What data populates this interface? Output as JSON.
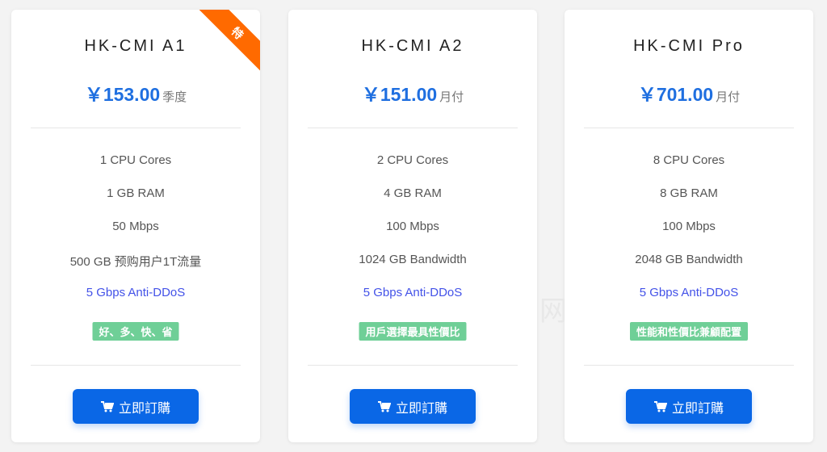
{
  "plans": [
    {
      "title": "HK-CMI A1",
      "price": "￥153.00",
      "period": "季度",
      "features": [
        "1 CPU Cores",
        "1 GB RAM",
        "50 Mbps",
        "500 GB 预购用户1T流量"
      ],
      "ddos": "5 Gbps Anti-DDoS",
      "badge": "好、多、快、省",
      "button_label": "立即訂購",
      "ribbon": "特"
    },
    {
      "title": "HK-CMI A2",
      "price": "￥151.00",
      "period": "月付",
      "features": [
        "2 CPU Cores",
        "4 GB RAM",
        "100 Mbps",
        "1024 GB Bandwidth"
      ],
      "ddos": "5 Gbps Anti-DDoS",
      "badge": "用戶選擇最具性價比",
      "button_label": "立即訂購"
    },
    {
      "title": "HK-CMI Pro",
      "price": "￥701.00",
      "period": "月付",
      "features": [
        "8 CPU Cores",
        "8 GB RAM",
        "100 Mbps",
        "2048 GB Bandwidth"
      ],
      "ddos": "5 Gbps Anti-DDoS",
      "badge": "性能和性價比兼顧配置",
      "button_label": "立即訂購"
    }
  ],
  "watermark": "网",
  "colors": {
    "accent": "#1f6fe0",
    "button": "#0a67e6",
    "ddos": "#4352e8",
    "badge": "#6fcf97",
    "ribbon": "#ff6a00"
  },
  "icons": {
    "button": "shopping-cart-icon"
  }
}
